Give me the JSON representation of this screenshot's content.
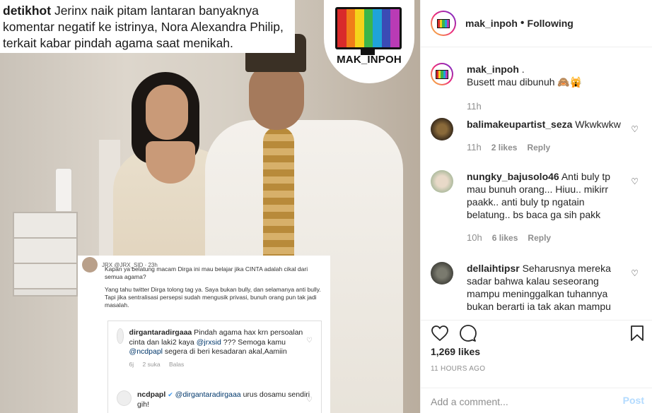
{
  "post": {
    "caption_user": "detikhot",
    "caption_text": "Jerinx naik pitam lantaran banyaknya komentar negatif ke istrinya, Nora Alexandra Philip, terkait kabar pindah agama saat menikah.",
    "logo_text": "MAK_INPOH",
    "tweet": {
      "user": "JRX @JRX_SID · 23h",
      "lines": [
        "Kapan ya belatung macam Dirga ini mau belajar jika CINTA adalah cikal dari semua agama?",
        "Yang tahu twitter Dirga tolong tag ya. Saya bukan bully, dan selamanya anti bully. Tapi jika sentralisasi persepsi sudah mengusik privasi, bunuh orang pun tak jadi masalah."
      ],
      "reply1": {
        "user": "dirgantaradirgaaa",
        "text_a": "Pindah agama hax krn persoalan cinta dan laki2 kaya",
        "mention_a": "@jrxsid",
        "text_b": "??? Semoga kamu",
        "mention_b": "@ncdpapl",
        "text_c": "segera di beri kesadaran akal,Aamiin",
        "age": "6j",
        "likes": "2 suka",
        "reply": "Balas"
      },
      "reply2": {
        "user": "ncdpapl",
        "mention": "@dirgantaradirgaaa",
        "text": "urus dosamu sendiri gih!"
      }
    }
  },
  "header": {
    "username": "mak_inpoh",
    "separator": "•",
    "follow_status": "Following"
  },
  "comments": [
    {
      "user": "mak_inpoh",
      "text": ".",
      "text2": "Busett mau dibunuh 🙈🙀",
      "time": "11h",
      "likes": "",
      "reply": ""
    },
    {
      "user": "balimakeupartist_seza",
      "text": "Wkwkwkw",
      "time": "11h",
      "likes": "2 likes",
      "reply": "Reply"
    },
    {
      "user": "nungky_bajusolo46",
      "text": "Anti buly tp mau bunuh orang... Hiuu.. mikirr paakk.. anti buly tp ngatain belatung.. bs baca ga sih pakk",
      "time": "10h",
      "likes": "6 likes",
      "reply": "Reply"
    },
    {
      "user": "dellaihtipsr",
      "text": "Seharusnya mereka sadar bahwa kalau seseorang mampu meninggalkan tuhannya bukan berarti ia tak akan mampu",
      "time": "",
      "likes": "",
      "reply": ""
    }
  ],
  "stats": {
    "likes": "1,269 likes",
    "ago": "11 HOURS AGO"
  },
  "add_comment": {
    "placeholder": "Add a comment...",
    "post_label": "Post"
  },
  "icons": {
    "like": "heart-icon",
    "comment": "comment-icon",
    "save": "bookmark-icon"
  },
  "colors": {
    "link": "#00376b",
    "muted": "#8e8e8e",
    "post_disabled": "#b3dbff"
  }
}
